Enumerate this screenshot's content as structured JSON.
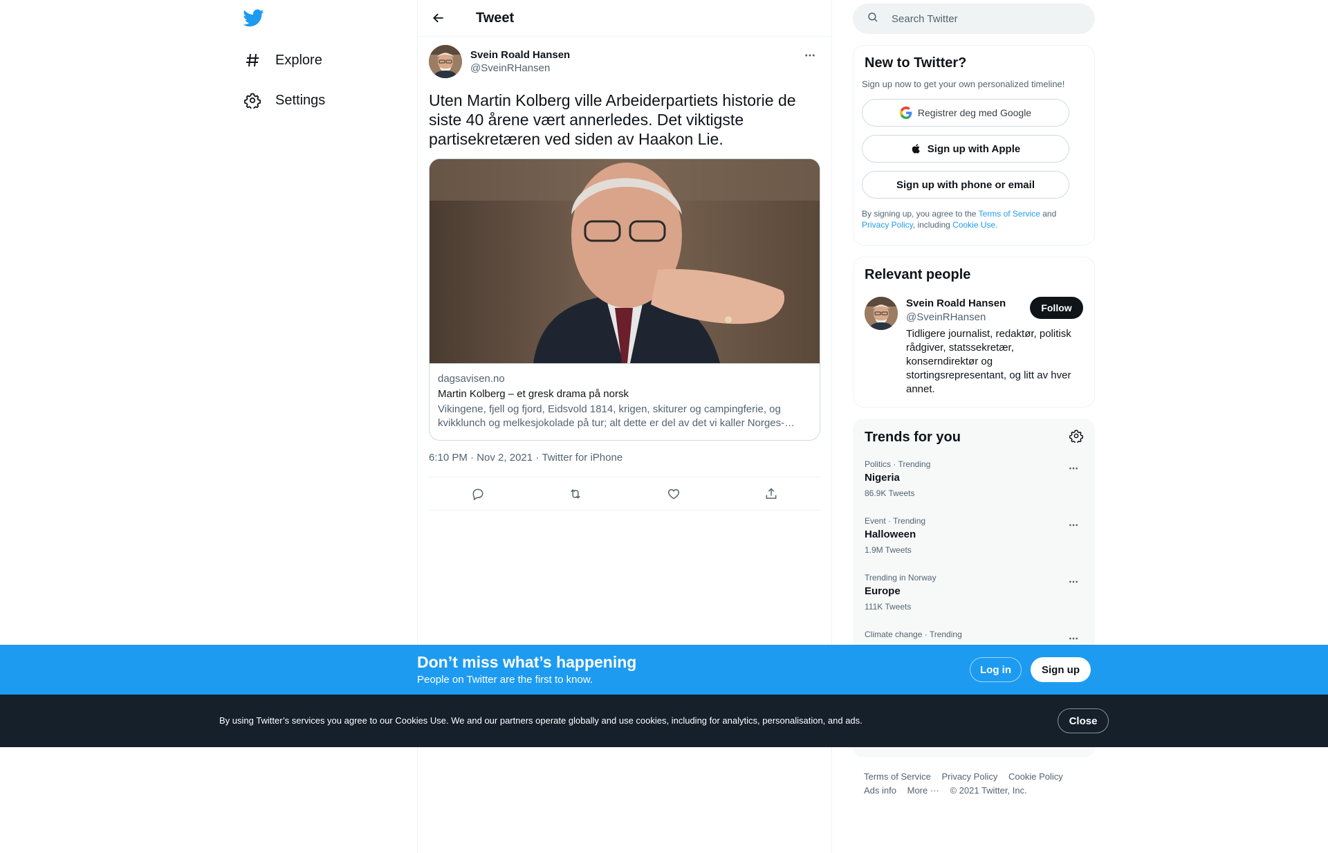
{
  "nav": {
    "logo_icon": "twitter-bird-icon",
    "explore_label": "Explore",
    "settings_label": "Settings"
  },
  "header": {
    "title": "Tweet"
  },
  "tweet": {
    "author_name": "Svein Roald Hansen",
    "author_handle": "@SveinRHansen",
    "text": "Uten Martin Kolberg ville Arbeiderpartiets historie de siste 40 årene vært annerledes. Det viktigste partisekretæren ved siden av Haakon Lie.",
    "card": {
      "domain": "dagsavisen.no",
      "title": "Martin Kolberg – et gresk drama på norsk",
      "description": "Vikingene, fjell og fjord, Eidsvold 1814, krigen, skiturer og campingferie, og kvikklunch og melkesjokolade på tur; alt dette er del av det vi kaller Norges-…"
    },
    "time": "6:10 PM",
    "date": "Nov 2, 2021",
    "source": "Twitter for iPhone",
    "separator": " · "
  },
  "search": {
    "placeholder": "Search Twitter"
  },
  "new_to_twitter": {
    "title": "New to Twitter?",
    "subtitle": "Sign up now to get your own personalized timeline!",
    "google_label": "Registrer deg med Google",
    "apple_label": "Sign up with Apple",
    "phone_label": "Sign up with phone or email",
    "legal_prefix": "By signing up, you agree to the ",
    "terms_link": "Terms of Service",
    "legal_and": " and ",
    "privacy_link": "Privacy Policy",
    "legal_including": ", including ",
    "cookie_link": "Cookie Use."
  },
  "relevant_people": {
    "title": "Relevant people",
    "person": {
      "name": "Svein Roald Hansen",
      "handle": "@SveinRHansen",
      "bio": "Tidligere journalist, redaktør, politisk rådgiver, statssekretær, konserndirektør og stortingsrepresentant, og litt av hver annet.",
      "follow_label": "Follow"
    }
  },
  "trends": {
    "title": "Trends for you",
    "items": [
      {
        "category": "Politics · Trending",
        "name": "Nigeria",
        "count": "86.9K Tweets"
      },
      {
        "category": "Event · Trending",
        "name": "Halloween",
        "count": "1.9M Tweets"
      },
      {
        "category": "Trending in Norway",
        "name": "Europe",
        "count": "111K Tweets"
      },
      {
        "category": "Climate change · Trending",
        "name": "",
        "count": ""
      }
    ]
  },
  "footer": {
    "terms": "Terms of Service",
    "privacy": "Privacy Policy",
    "cookie": "Cookie Policy",
    "ads": "Ads info",
    "more": "More ···",
    "copyright": "© 2021 Twitter, Inc."
  },
  "banner": {
    "title": "Don’t miss what’s happening",
    "subtitle": "People on Twitter are the first to know.",
    "login_label": "Log in",
    "signup_label": "Sign up"
  },
  "cookie_bar": {
    "text": "By using Twitter’s services you agree to our Cookies Use. We and our partners operate globally and use cookies, including for analytics, personalisation, and ads.",
    "close_label": "Close"
  },
  "colors": {
    "accent": "#1d9bf0",
    "text": "#0f1419",
    "muted": "#536471",
    "dark_bar": "#15202b"
  }
}
